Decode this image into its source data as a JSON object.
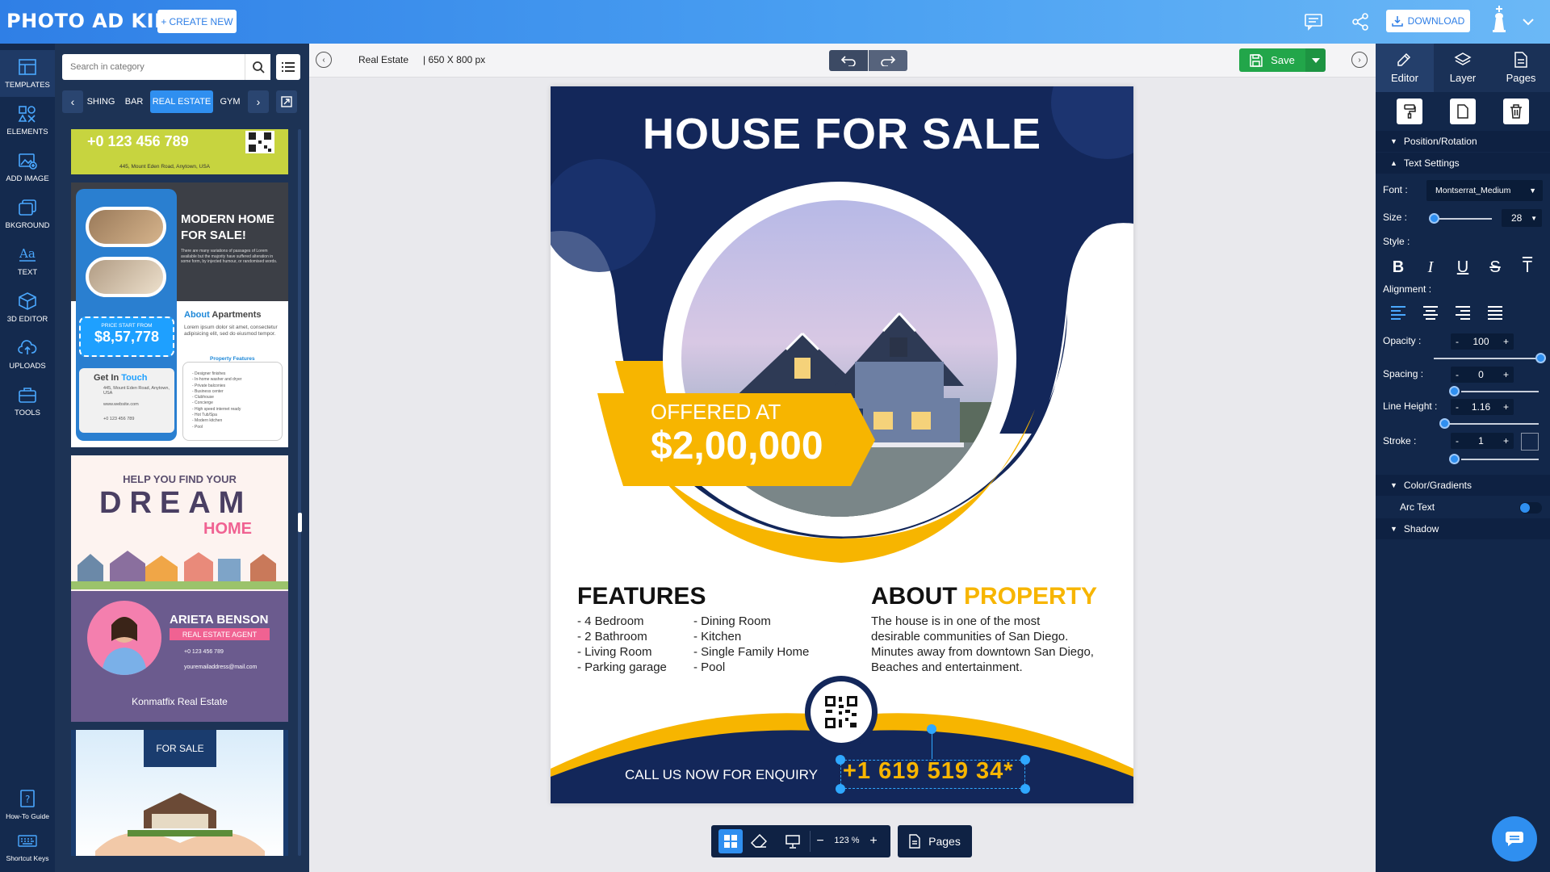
{
  "app": {
    "logo": "PHOTO AD KING",
    "create_new": "CREATE NEW",
    "download": "DOWNLOAD"
  },
  "left_nav": [
    {
      "label": "TEMPLATES",
      "icon": "templates-icon"
    },
    {
      "label": "ELEMENTS",
      "icon": "elements-icon"
    },
    {
      "label": "ADD IMAGE",
      "icon": "add-image-icon"
    },
    {
      "label": "BKGROUND",
      "icon": "background-icon"
    },
    {
      "label": "TEXT",
      "icon": "text-icon"
    },
    {
      "label": "3D EDITOR",
      "icon": "3d-editor-icon"
    },
    {
      "label": "UPLOADS",
      "icon": "uploads-icon"
    },
    {
      "label": "TOOLS",
      "icon": "tools-icon"
    },
    {
      "label": "How-To Guide",
      "icon": "guide-icon"
    },
    {
      "label": "Shortcut Keys",
      "icon": "keyboard-icon"
    }
  ],
  "template_panel": {
    "search_placeholder": "Search in category",
    "categories": [
      "SHING",
      "BAR",
      "REAL ESTATE",
      "GYM"
    ],
    "active_category": "REAL ESTATE",
    "templates": {
      "t1": {
        "phone": "+0 123 456 789",
        "address": "445, Mount Eden Road, Anytown, USA"
      },
      "t2": {
        "title": "MODERN HOME FOR SALE!",
        "body": "There are many variations of passages of Lorem available but the majority have suffered alteration in some form, by injected humour, or randomised words.",
        "price_caption": "PRICE START FROM",
        "price": "$8,57,778",
        "about_a": "About",
        "about_b": "Apartments",
        "about_text": "Lorem ipsum dolor sit amet, consectetur adipisicing elit, sed do eiusmod tempor.",
        "contact_a": "Get In",
        "contact_b": "Touch",
        "contact_address": "445, Mount Eden Road, Anytown, USA",
        "contact_web": "www.website.com",
        "contact_phone": "+0 123 456 789",
        "features_title": "Property Features",
        "features": [
          "Designer finishes",
          "In-home washer and dryer",
          "Private balconies",
          "Business center",
          "Clubhouse",
          "Concierge",
          "High speed internet ready",
          "Hot Tub/Spa",
          "Modern kitchen",
          "Pool"
        ]
      },
      "t3": {
        "line1": "HELP YOU FIND YOUR",
        "line2": "DREAM",
        "line3": "HOME",
        "agent_name": "ARIETA BENSON",
        "agent_role": "REAL ESTATE AGENT",
        "agent_phone": "+0 123 456 789",
        "agent_email": "youremailaddress@mail.com",
        "company": "Konmatfix Real Estate"
      },
      "t4": {
        "banner": "FOR SALE"
      }
    }
  },
  "canvas_toolbar": {
    "category": "Real Estate",
    "size": "| 650 X 800 px",
    "save": "Save"
  },
  "flyer": {
    "title": "HOUSE FOR SALE",
    "offered_label": "OFFERED AT",
    "price": "$2,00,000",
    "features_title": "FEATURES",
    "features_col1": [
      "- 4 Bedroom",
      "- 2 Bathroom",
      "- Living Room",
      "- Parking garage"
    ],
    "features_col2": [
      "- Dining Room",
      "- Kitchen",
      "- Single Family Home",
      "- Pool"
    ],
    "about_a": "ABOUT",
    "about_b": "PROPERTY",
    "about_lines": [
      "The house is in one of the most",
      "desirable communities of San Diego.",
      "Minutes away from downtown San Diego,",
      "Beaches and entertainment."
    ],
    "cta": "CALL US NOW FOR ENQUIRY",
    "phone": "+1 619 519 34*",
    "colors": {
      "navy": "#13275a",
      "yellow": "#f7b500"
    }
  },
  "bottom_bar": {
    "zoom": "123 %",
    "pages": "Pages"
  },
  "right_panel": {
    "tabs": [
      "Editor",
      "Layer",
      "Pages"
    ],
    "position_rotation": "Position/Rotation",
    "text_settings": "Text Settings",
    "font_label": "Font :",
    "font_value": "Montserrat_Medium",
    "size_label": "Size :",
    "size_value": "28",
    "style_label": "Style :",
    "alignment_label": "Alignment :",
    "opacity_label": "Opacity :",
    "opacity_value": "100",
    "spacing_label": "Spacing :",
    "spacing_value": "0",
    "line_height_label": "Line Height :",
    "line_height_value": "1.16",
    "stroke_label": "Stroke :",
    "stroke_value": "1",
    "color_gradients": "Color/Gradients",
    "arc_text": "Arc Text",
    "shadow": "Shadow",
    "minus": "-",
    "plus": "+"
  }
}
